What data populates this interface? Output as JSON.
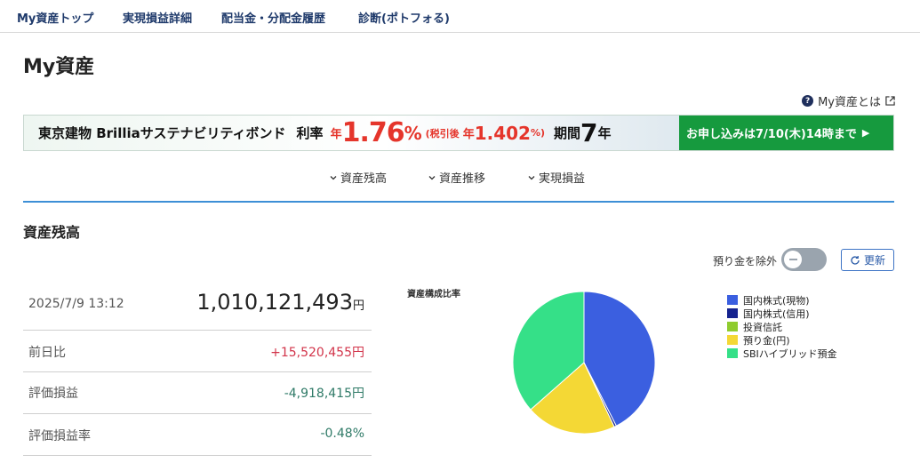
{
  "nav": {
    "items": [
      {
        "label": "My資産トップ"
      },
      {
        "label": "実現損益詳細"
      },
      {
        "label": "配当金・分配金履歴"
      },
      {
        "label": "診断(ポトフォる)"
      }
    ]
  },
  "page": {
    "title": "My資産",
    "help_label": "My資産とは"
  },
  "banner": {
    "name": "東京建物 Brilliaサステナビリティボンド",
    "rate_label": "利率",
    "rate_nen": "年",
    "rate": "1.76",
    "rate_pct": "%",
    "after_tax_label": "(税引後",
    "after_tax_nen": "年",
    "after_tax_rate": "1.402",
    "after_tax_close": "%)",
    "period_label": "期間",
    "period_value": "7",
    "period_unit": "年",
    "cta": "お申し込みは7/10(木)14時まで",
    "colors": {
      "accent": "#e5352b",
      "cta_bg": "#169a3e"
    }
  },
  "anchors": [
    {
      "label": "資産残高"
    },
    {
      "label": "資産推移"
    },
    {
      "label": "実現損益"
    }
  ],
  "balance": {
    "section_title": "資産残高",
    "toggle_label": "預り金を除外",
    "toggle_on": false,
    "refresh_label": "更新",
    "timestamp": "2025/7/9 13:12",
    "total": "1,010,121,493",
    "total_unit": "円",
    "rows": [
      {
        "label": "前日比",
        "value": "+15,520,455円"
      },
      {
        "label": "評価損益",
        "value": "-4,918,415円"
      },
      {
        "label": "評価損益率",
        "value": "-0.48%"
      }
    ]
  },
  "chart_data": {
    "type": "pie",
    "title": "資産構成比率",
    "categories": [
      "国内株式(現物)",
      "国内株式(信用)",
      "投資信託",
      "預り金(円)",
      "SBIハイブリッド預金"
    ],
    "values": [
      42.5,
      0.5,
      0.0,
      20.5,
      36.5
    ],
    "colors": [
      "#3b5fe0",
      "#15238f",
      "#8fcc2f",
      "#f4d835",
      "#35e088"
    ],
    "legend": "right"
  }
}
